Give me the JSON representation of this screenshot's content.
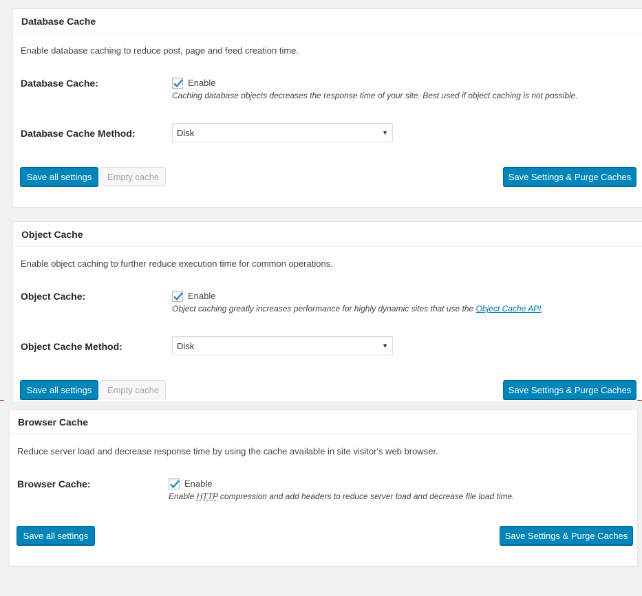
{
  "database_cache": {
    "title": "Database Cache",
    "description": "Enable database caching to reduce post, page and feed creation time.",
    "row_label": "Database Cache:",
    "checkbox_label": "Enable",
    "checked": true,
    "note": "Caching database objects decreases the response time of your site. Best used if object caching is not possible.",
    "method_label": "Database Cache Method:",
    "method_value": "Disk",
    "save_label": "Save all settings",
    "empty_label": "Empty cache",
    "purge_label": "Save Settings & Purge Caches"
  },
  "object_cache": {
    "title": "Object Cache",
    "description": "Enable object caching to further reduce execution time for common operations.",
    "row_label": "Object Cache:",
    "checkbox_label": "Enable",
    "checked": true,
    "note_prefix": "Object caching greatly increases performance for highly dynamic sites that use the ",
    "note_link": "Object Cache API",
    "note_suffix": ".",
    "method_label": "Object Cache Method:",
    "method_value": "Disk",
    "save_label": "Save all settings",
    "empty_label": "Empty cache",
    "purge_label": "Save Settings & Purge Caches"
  },
  "browser_cache": {
    "title": "Browser Cache",
    "description": "Reduce server load and decrease response time by using the cache available in site visitor's web browser.",
    "row_label": "Browser Cache:",
    "checkbox_label": "Enable",
    "checked": true,
    "note_prefix": "Enable ",
    "note_abbr": "HTTP",
    "note_suffix": " compression and add headers to reduce server load and decrease file load time.",
    "save_label": "Save all settings",
    "purge_label": "Save Settings & Purge Caches"
  },
  "colors": {
    "primary": "#0085ba",
    "link": "#0073aa",
    "checkmark": "#1e8cbe",
    "accent_line": "#d54e21"
  }
}
